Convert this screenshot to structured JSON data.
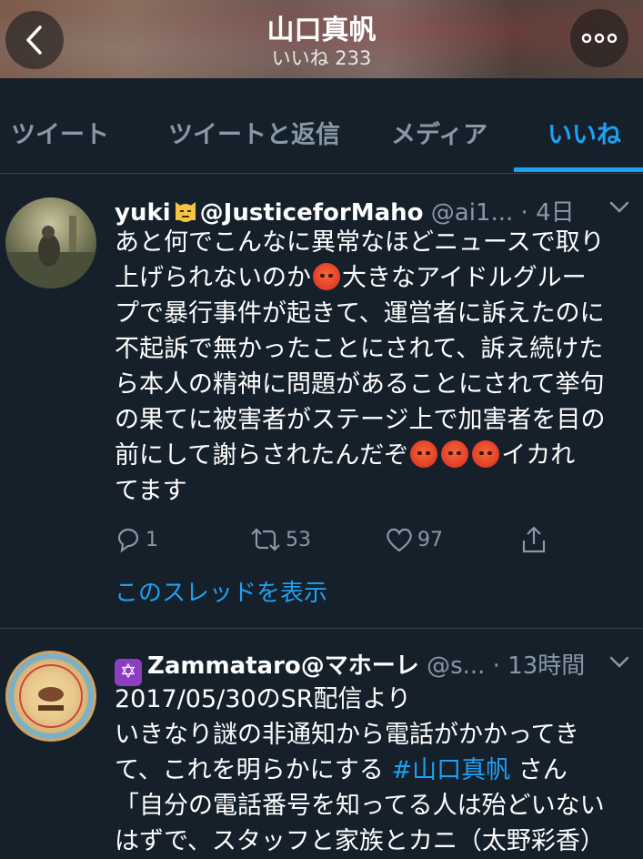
{
  "header": {
    "title": "山口真帆",
    "subtitle": "いいね 233",
    "back_icon": "chevron-left-icon",
    "more_icon": "more-horizontal-icon"
  },
  "tabs": [
    {
      "label": "ツイート",
      "active": false
    },
    {
      "label": "ツイートと返信",
      "active": false
    },
    {
      "label": "メディア",
      "active": false
    },
    {
      "label": "いいね",
      "active": true
    }
  ],
  "colors": {
    "accent": "#1da1f2",
    "background": "#15202b",
    "muted": "#8899a6",
    "divider": "#38444d"
  },
  "tweets": [
    {
      "name_prefix": "yuki",
      "name_suffix": "@JusticeforMaho",
      "handle": "@ai1...",
      "time": "· 4日",
      "lines": [
        "あと何でこんなに異常なほどニュースで取り",
        "上げられないのか",
        "大きなアイドルグルー",
        "プで暴行事件が起きて、運営者に訴えたのに",
        "不起訴で無かったことにされて、訴え続けた",
        "ら本人の精神に問題があることにされて挙句",
        "の果てに被害者がステージ上で加害者を目の",
        "前にして謝らされたんだぞ",
        "イカれ",
        "てます"
      ],
      "reply_count": "1",
      "retweet_count": "53",
      "like_count": "97",
      "thread_link": "このスレッドを表示"
    },
    {
      "name": "Zammataro@マホーレ",
      "handle": "@s...",
      "time": "· 13時間",
      "lines": [
        "2017/05/30のSR配信より",
        "いきなり謎の非通知から電話がかかってき",
        "て、これを明らかにする",
        "#山口真帆",
        " さん",
        "「自分の電話番号を知ってる人は殆どいない",
        "はずで、スタッフと家族とカニ（太野彩香）"
      ]
    }
  ]
}
